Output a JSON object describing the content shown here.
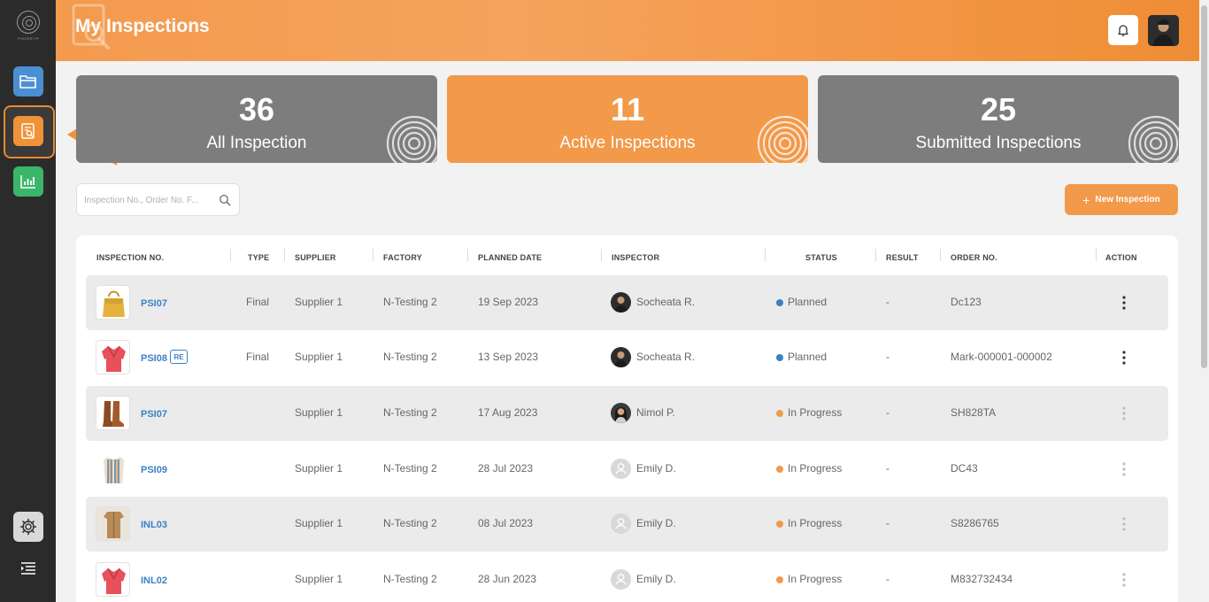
{
  "sidebar": {
    "logo_text": "FINGERTIP",
    "items": [
      {
        "name": "folder-icon"
      },
      {
        "name": "inspection-search-icon"
      },
      {
        "name": "bar-chart-icon"
      }
    ],
    "settings_icon": "gear-icon",
    "menu_icon": "menu-collapse-icon"
  },
  "header": {
    "title": "My Inspections",
    "bell_icon": "bell-icon"
  },
  "cards": [
    {
      "count": "36",
      "label": "All Inspection"
    },
    {
      "count": "11",
      "label": "Active Inspections"
    },
    {
      "count": "25",
      "label": "Submitted Inspections"
    }
  ],
  "search": {
    "placeholder": "Inspection No., Order No. F..."
  },
  "new_button": {
    "plus": "+",
    "label": "New Inspection"
  },
  "table": {
    "headers": {
      "inspection_no": "INSPECTION NO.",
      "type": "TYPE",
      "supplier": "SUPPLIER",
      "factory": "FACTORY",
      "planned_date": "PLANNED DATE",
      "inspector": "INSPECTOR",
      "status": "STATUS",
      "result": "RESULT",
      "order_no": "ORDER NO.",
      "action": "ACTION"
    },
    "rows": [
      {
        "no": "PSI07",
        "re": "",
        "type": "Final",
        "supplier": "Supplier 1",
        "factory": "N-Testing 2",
        "date": "19 Sep 2023",
        "inspector": "Socheata R.",
        "status": "Planned",
        "result": "-",
        "order": "Dc123",
        "product": "yellow-bag"
      },
      {
        "no": "PSI08",
        "re": "RE",
        "type": "Final",
        "supplier": "Supplier 1",
        "factory": "N-Testing 2",
        "date": "13 Sep 2023",
        "inspector": "Socheata R.",
        "status": "Planned",
        "result": "-",
        "order": "Mark-000001-000002",
        "product": "pink-blazer"
      },
      {
        "no": "PSI07",
        "re": "",
        "type": "",
        "supplier": "Supplier 1",
        "factory": "N-Testing 2",
        "date": "17 Aug 2023",
        "inspector": "Nimol P.",
        "status": "In Progress",
        "result": "-",
        "order": "SH828TA",
        "product": "brown-boots"
      },
      {
        "no": "PSI09",
        "re": "",
        "type": "",
        "supplier": "Supplier 1",
        "factory": "N-Testing 2",
        "date": "28 Jul 2023",
        "inspector": "Emily D.",
        "status": "In Progress",
        "result": "-",
        "order": "DC43",
        "product": "striped-shirt"
      },
      {
        "no": "INL03",
        "re": "",
        "type": "",
        "supplier": "Supplier 1",
        "factory": "N-Testing 2",
        "date": "08 Jul 2023",
        "inspector": "Emily D.",
        "status": "In Progress",
        "result": "-",
        "order": "S8286765",
        "product": "tan-coat"
      },
      {
        "no": "INL02",
        "re": "",
        "type": "",
        "supplier": "Supplier 1",
        "factory": "N-Testing 2",
        "date": "28 Jun 2023",
        "inspector": "Emily D.",
        "status": "In Progress",
        "result": "-",
        "order": "M832732434",
        "product": "pink-blazer"
      }
    ]
  },
  "colors": {
    "accent": "#f2994a",
    "header_gradient_start": "#f39a4e",
    "header_gradient_end": "#ef8d35",
    "link": "#3b82c4",
    "status_planned": "#3b82c4",
    "status_in_progress": "#f2994a",
    "card_grey": "#7d7d7d",
    "sidebar": "#2b2b2b"
  }
}
